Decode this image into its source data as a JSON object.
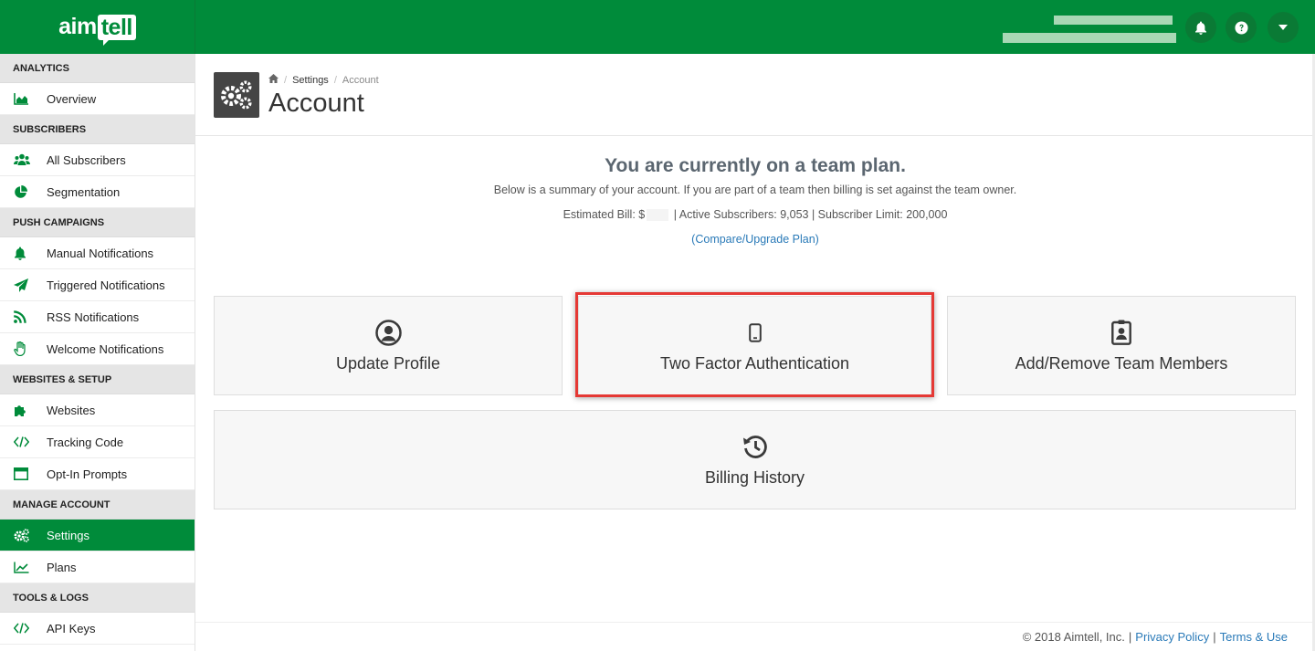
{
  "brand": {
    "logo_part1": "aim",
    "logo_part2": "tell"
  },
  "header": {
    "notifications_icon": "bell-icon",
    "help_icon": "question-circle-icon",
    "menu_icon": "caret-down-icon"
  },
  "sidebar": {
    "sections": [
      {
        "title": "ANALYTICS",
        "items": [
          {
            "label": "Overview",
            "icon": "area-chart-icon"
          }
        ]
      },
      {
        "title": "SUBSCRIBERS",
        "items": [
          {
            "label": "All Subscribers",
            "icon": "users-icon"
          },
          {
            "label": "Segmentation",
            "icon": "pie-chart-icon"
          }
        ]
      },
      {
        "title": "PUSH CAMPAIGNS",
        "items": [
          {
            "label": "Manual Notifications",
            "icon": "bell-icon"
          },
          {
            "label": "Triggered Notifications",
            "icon": "paper-plane-icon"
          },
          {
            "label": "RSS Notifications",
            "icon": "rss-icon"
          },
          {
            "label": "Welcome Notifications",
            "icon": "hand-wave-icon"
          }
        ]
      },
      {
        "title": "WEBSITES & SETUP",
        "items": [
          {
            "label": "Websites",
            "icon": "puzzle-icon"
          },
          {
            "label": "Tracking Code",
            "icon": "code-icon"
          },
          {
            "label": "Opt-In Prompts",
            "icon": "window-icon"
          }
        ]
      },
      {
        "title": "MANAGE ACCOUNT",
        "items": [
          {
            "label": "Settings",
            "icon": "gears-icon",
            "active": true
          },
          {
            "label": "Plans",
            "icon": "line-chart-icon"
          }
        ]
      },
      {
        "title": "TOOLS & LOGS",
        "items": [
          {
            "label": "API Keys",
            "icon": "code-icon"
          }
        ]
      }
    ]
  },
  "breadcrumb": {
    "home_icon": "home-icon",
    "settings": "Settings",
    "current": "Account"
  },
  "page": {
    "title": "Account"
  },
  "summary": {
    "heading": "You are currently on a team plan.",
    "description": "Below is a summary of your account. If you are part of a team then billing is set against the team owner.",
    "bill_label": "Estimated Bill: $",
    "stats": "| Active Subscribers: 9,053 | Subscriber Limit: 200,000",
    "upgrade_link": "(Compare/Upgrade Plan)"
  },
  "cards": {
    "update_profile": "Update Profile",
    "two_factor": "Two Factor Authentication",
    "team_members": "Add/Remove Team Members",
    "billing_history": "Billing History"
  },
  "footer": {
    "copyright": "© 2018 Aimtell, Inc.",
    "privacy": "Privacy Policy",
    "terms": "Terms & Use"
  },
  "colors": {
    "brand_green": "#008b3a",
    "highlight_red": "#e53935",
    "link_blue": "#2a7ab8"
  }
}
